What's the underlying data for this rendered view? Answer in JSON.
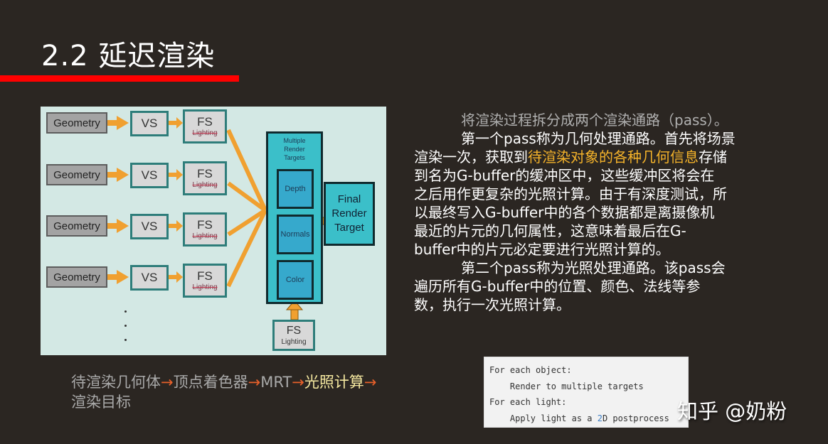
{
  "slide": {
    "title": "2.2 延迟渲染",
    "accent_color": "#ff0000"
  },
  "diagram": {
    "rows": [
      {
        "geometry": "Geometry",
        "vs": "VS",
        "fs": "FS",
        "fs_sub": "Lighting"
      },
      {
        "geometry": "Geometry",
        "vs": "VS",
        "fs": "FS",
        "fs_sub": "Lighting"
      },
      {
        "geometry": "Geometry",
        "vs": "VS",
        "fs": "FS",
        "fs_sub": "Lighting"
      },
      {
        "geometry": "Geometry",
        "vs": "VS",
        "fs": "FS",
        "fs_sub": "Lighting"
      }
    ],
    "mrt": {
      "label_lines": [
        "Multiple",
        "Render",
        "Targets"
      ],
      "targets": [
        "Depth",
        "Normals",
        "Color"
      ]
    },
    "final": {
      "lines": [
        "Final",
        "Render",
        "Target"
      ]
    },
    "lighting_pass": {
      "fs": "FS",
      "sub": "Lighting"
    },
    "arrow_color": "#f0a030"
  },
  "caption": {
    "parts": [
      {
        "text": "待渲染几何体",
        "style": "normal"
      },
      {
        "text": "→",
        "style": "arrow"
      },
      {
        "text": "顶点着色器",
        "style": "normal"
      },
      {
        "text": "→",
        "style": "arrow"
      },
      {
        "text": "MRT",
        "style": "normal"
      },
      {
        "text": "→",
        "style": "arrow"
      },
      {
        "text": "光照计算",
        "style": "highlight"
      },
      {
        "text": "→",
        "style": "arrow"
      },
      {
        "text": "渲染目标",
        "style": "normal"
      }
    ]
  },
  "paragraph": {
    "lines": [
      {
        "indent": true,
        "segments": [
          {
            "text": "将渲染过程拆分成两个渲染通路（pass）。",
            "style": "gray"
          }
        ]
      },
      {
        "indent": true,
        "segments": [
          {
            "text": "第一个pass称为几何处理通路。首先将场景",
            "style": "normal"
          }
        ]
      },
      {
        "indent": false,
        "segments": [
          {
            "text": "渲染一次，获取到",
            "style": "normal"
          },
          {
            "text": "待渲染对象的各种几何信息",
            "style": "orange"
          },
          {
            "text": "存储",
            "style": "normal"
          }
        ]
      },
      {
        "indent": false,
        "segments": [
          {
            "text": "到名为G-buffer的缓冲区中，这些缓冲区将会在",
            "style": "normal"
          }
        ]
      },
      {
        "indent": false,
        "segments": [
          {
            "text": "之后用作更复杂的光照计算。由于有深度测试，所",
            "style": "normal"
          }
        ]
      },
      {
        "indent": false,
        "segments": [
          {
            "text": "以最终写入G-buffer中的各个数据都是离摄像机",
            "style": "normal"
          }
        ]
      },
      {
        "indent": false,
        "segments": [
          {
            "text": "最近的片元的几何属性，这意味着最后在G-",
            "style": "normal"
          }
        ]
      },
      {
        "indent": false,
        "segments": [
          {
            "text": "buffer中的片元必定要进行光照计算的。",
            "style": "normal"
          }
        ]
      },
      {
        "indent": true,
        "segments": [
          {
            "text": "第二个pass称为光照处理通路。该pass会",
            "style": "normal"
          }
        ]
      },
      {
        "indent": false,
        "segments": [
          {
            "text": "遍历所有G-buffer中的位置、颜色、法线等参",
            "style": "normal"
          }
        ]
      },
      {
        "indent": false,
        "segments": [
          {
            "text": "数，执行一次光照计算。",
            "style": "normal"
          }
        ]
      }
    ]
  },
  "code": {
    "lines": [
      "For each object:",
      "    Render to multiple targets",
      "For each light:",
      "    Apply light as a 2D postprocess"
    ]
  },
  "watermark": "知乎 @奶粉"
}
